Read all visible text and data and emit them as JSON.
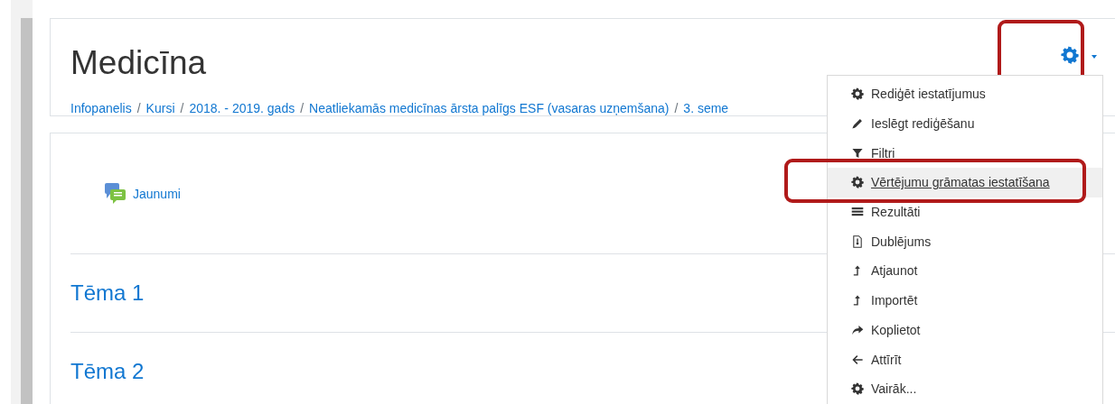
{
  "header": {
    "title": "Medicīna",
    "breadcrumb": [
      {
        "kind": "link",
        "text": "Infopanelis"
      },
      {
        "kind": "separator",
        "text": "/"
      },
      {
        "kind": "link",
        "text": "Kursi"
      },
      {
        "kind": "separator",
        "text": "/"
      },
      {
        "kind": "link",
        "text": "2018. - 2019. gads"
      },
      {
        "kind": "separator",
        "text": "/"
      },
      {
        "kind": "link",
        "text": "Neatliekamās medicīnas ārsta palīgs ESF (vasaras uzņemšana)"
      },
      {
        "kind": "separator",
        "text": "/"
      },
      {
        "kind": "link",
        "text": "3. seme"
      }
    ],
    "settings_gear": {
      "highlighted": true,
      "expanded": true
    }
  },
  "course": {
    "news": {
      "label": "Jaunumi"
    },
    "sections": [
      "Tēma 1",
      "Tēma 2"
    ]
  },
  "action_menu": [
    {
      "kind": "gear",
      "label": "Rediģēt iestatījumus",
      "selected": false,
      "highlighted": false
    },
    {
      "kind": "pencil",
      "label": "Ieslēgt rediģēšanu",
      "selected": false,
      "highlighted": false
    },
    {
      "kind": "filter",
      "label": "Filtri",
      "selected": false,
      "highlighted": false
    },
    {
      "kind": "gear",
      "label": "Vērtējumu grāmatas iestatīšana",
      "selected": true,
      "highlighted": true
    },
    {
      "kind": "table",
      "label": "Rezultāti",
      "selected": false,
      "highlighted": false
    },
    {
      "kind": "file",
      "label": "Dublējums",
      "selected": false,
      "highlighted": false
    },
    {
      "kind": "upload",
      "label": "Atjaunot",
      "selected": false,
      "highlighted": false
    },
    {
      "kind": "upload",
      "label": "Importēt",
      "selected": false,
      "highlighted": false
    },
    {
      "kind": "share",
      "label": "Koplietot",
      "selected": false,
      "highlighted": false
    },
    {
      "kind": "back",
      "label": "Attīrīt",
      "selected": false,
      "highlighted": false
    },
    {
      "kind": "gear",
      "label": "Vairāk...",
      "selected": false,
      "highlighted": false
    }
  ]
}
